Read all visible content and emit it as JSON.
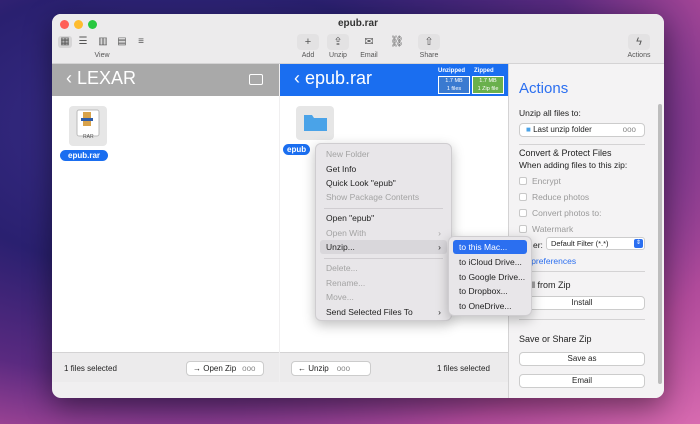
{
  "window": {
    "title": "epub.rar"
  },
  "toolbar": {
    "view_label": "View",
    "add": "Add",
    "unzip": "Unzip",
    "email": "Email",
    "link": "",
    "share": "Share",
    "actions": "Actions"
  },
  "left_pane": {
    "title": "LEXAR",
    "file_name": "epub.rar",
    "file_icon_text": "RAR",
    "status": "1 files selected",
    "open_zip": "Open Zip",
    "more": "ooo"
  },
  "right_pane": {
    "title": "epub.rar",
    "file_name": "epub",
    "status": "1 files selected",
    "unzip": "Unzip",
    "more": "ooo",
    "stats": {
      "unzipped_label": "Unzipped",
      "zipped_label": "Zipped",
      "unzipped_size": "1.7 MB",
      "unzipped_files": "1 files",
      "zipped_size": "1.7 MB",
      "zipped_files": "1 Zip file"
    }
  },
  "context_menu": {
    "items": [
      "New Folder",
      "Get Info",
      "Quick Look \"epub\"",
      "Show Package Contents",
      "Open \"epub\"",
      "Open With",
      "Unzip...",
      "Delete...",
      "Rename...",
      "Move...",
      "Send Selected Files To"
    ]
  },
  "submenu": {
    "items": [
      "to this Mac...",
      "to iCloud Drive...",
      "to Google Drive...",
      "to Dropbox...",
      "to OneDrive..."
    ]
  },
  "actions_panel": {
    "title": "Actions",
    "unzip_all": "Unzip all files to:",
    "last_folder": "Last unzip folder",
    "more": "ooo",
    "convert_title": "Convert & Protect Files",
    "when_adding": "When adding files to this zip:",
    "options": [
      "Encrypt",
      "Reduce photos",
      "Convert photos to:",
      "Watermark"
    ],
    "filter_label": "er:",
    "filter_value": "Default Filter (*.*)",
    "prefs_link": "r preferences",
    "install_title": "all from Zip",
    "install_btn": "Install",
    "share_title": "Save or Share Zip",
    "save_as": "Save as",
    "email": "Email"
  },
  "colors": {
    "accent": "#1a6ef0",
    "lexar_header": "#a9a9a9"
  }
}
